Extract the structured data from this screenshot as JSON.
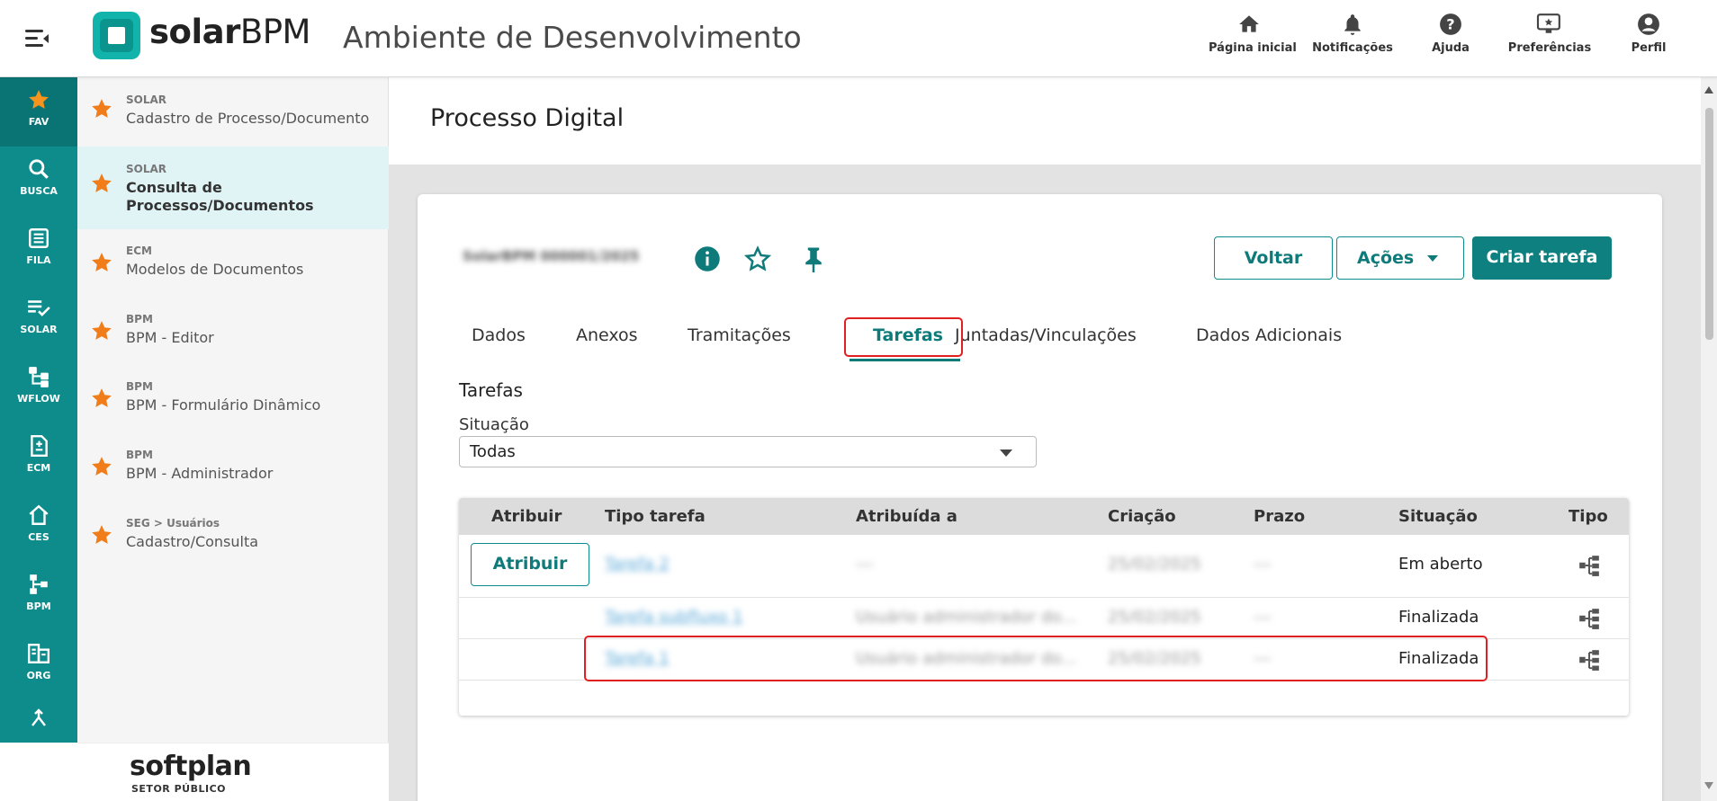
{
  "app": {
    "logo_bold": "solar",
    "logo_light": "BPM",
    "environment_title": "Ambiente de Desenvolvimento"
  },
  "header_nav": [
    {
      "label": "Página inicial",
      "icon": "home-icon"
    },
    {
      "label": "Notificações",
      "icon": "bell-icon"
    },
    {
      "label": "Ajuda",
      "icon": "help-icon"
    },
    {
      "label": "Preferências",
      "icon": "preferences-icon"
    },
    {
      "label": "Perfil",
      "icon": "profile-icon"
    }
  ],
  "rail": [
    {
      "label": "FAV",
      "icon": "star-icon",
      "active": true
    },
    {
      "label": "BUSCA",
      "icon": "search-icon"
    },
    {
      "label": "FILA",
      "icon": "queue-icon"
    },
    {
      "label": "SOLAR",
      "icon": "checklist-icon"
    },
    {
      "label": "WFLOW",
      "icon": "workflow-icon"
    },
    {
      "label": "ECM",
      "icon": "document-icon"
    },
    {
      "label": "CES",
      "icon": "house-icon"
    },
    {
      "label": "BPM",
      "icon": "bpm-icon"
    },
    {
      "label": "ORG",
      "icon": "org-icon"
    },
    {
      "label": "",
      "icon": "merge-icon"
    }
  ],
  "favorites": [
    {
      "category": "SOLAR",
      "name": "Cadastro de Processo/Documento"
    },
    {
      "category": "SOLAR",
      "name": "Consulta de Processos/Documentos",
      "active": true
    },
    {
      "category": "ECM",
      "name": "Modelos de Documentos"
    },
    {
      "category": "BPM",
      "name": "BPM - Editor"
    },
    {
      "category": "BPM",
      "name": "BPM - Formulário Dinâmico"
    },
    {
      "category": "BPM",
      "name": "BPM - Administrador"
    },
    {
      "category": "SEG > Usuários",
      "name": "Cadastro/Consulta"
    }
  ],
  "footer_brand": {
    "name": "softplan",
    "subtitle": "SETOR PÚBLICO"
  },
  "page": {
    "title": "Processo Digital",
    "process_id": "SolarBPM 000001/2025"
  },
  "actions": {
    "voltar": "Voltar",
    "acoes": "Ações",
    "criar_tarefa": "Criar tarefa"
  },
  "tabs": [
    {
      "label": "Dados"
    },
    {
      "label": "Anexos"
    },
    {
      "label": "Tramitações"
    },
    {
      "label": "Tarefas",
      "active": true
    },
    {
      "label": "Juntadas/Vinculações"
    },
    {
      "label": "Dados Adicionais"
    }
  ],
  "tarefas": {
    "section_title": "Tarefas",
    "filter_label": "Situação",
    "filter_value": "Todas",
    "columns": [
      "Atribuir",
      "Tipo tarefa",
      "Atribuída a",
      "Criação",
      "Prazo",
      "Situação",
      "Tipo"
    ],
    "rows": [
      {
        "atribuir": "Atribuir",
        "tipo_tarefa": "Tarefa 2",
        "atribuida_a": "---",
        "criacao": "25/02/2025",
        "prazo": "---",
        "situacao": "Em aberto"
      },
      {
        "atribuir": "",
        "tipo_tarefa": "Tarefa subfluxo 1",
        "atribuida_a": "Usuário administrador do...",
        "criacao": "25/02/2025",
        "prazo": "---",
        "situacao": "Finalizada"
      },
      {
        "atribuir": "",
        "tipo_tarefa": "Tarefa 1",
        "atribuida_a": "Usuário administrador do...",
        "criacao": "25/02/2025",
        "prazo": "---",
        "situacao": "Finalizada"
      }
    ]
  },
  "colors": {
    "primary": "#0e8c8c",
    "accent_star": "#f07d1a",
    "highlight": "#e02020"
  }
}
